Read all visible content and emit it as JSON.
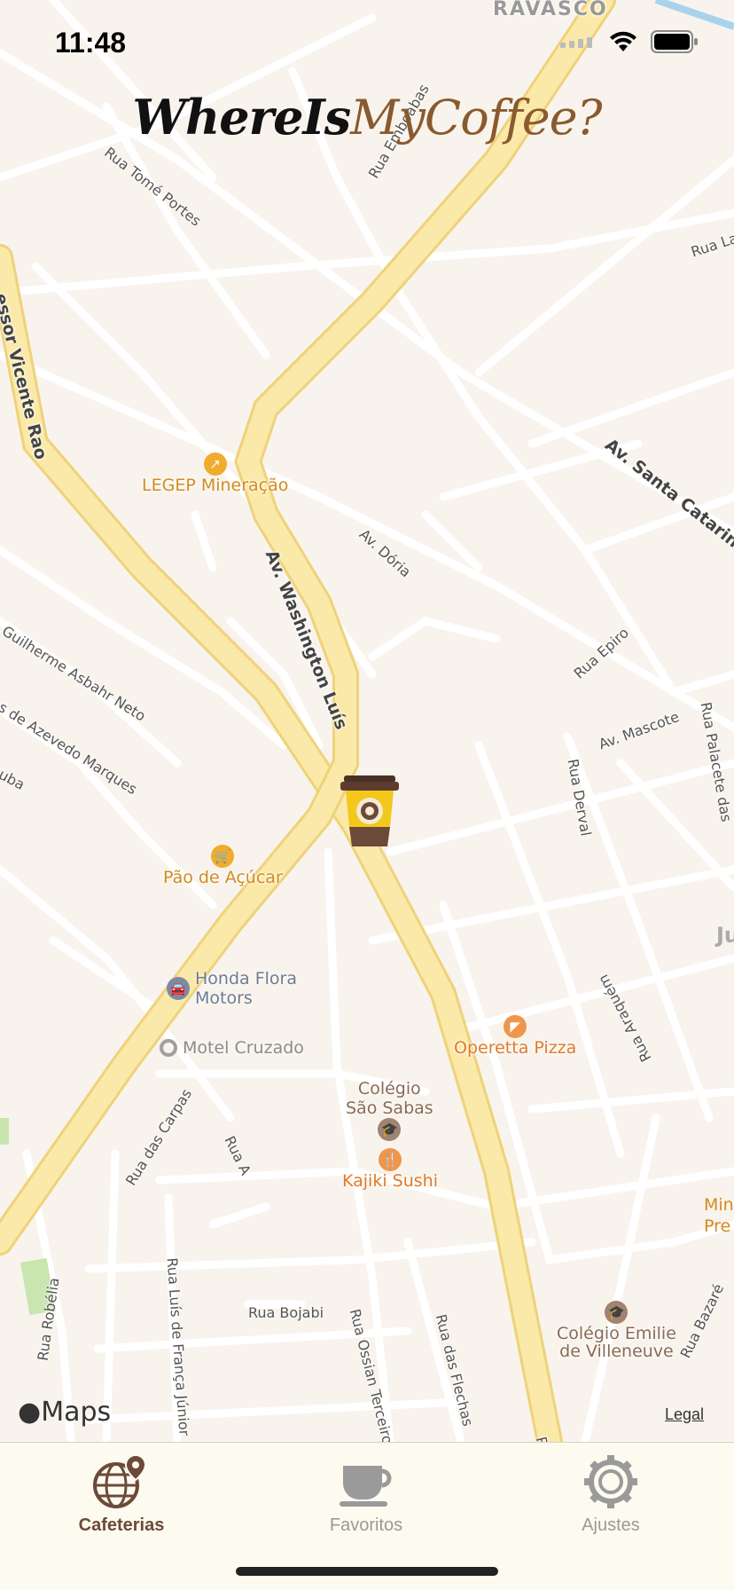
{
  "status_bar": {
    "time": "11:48"
  },
  "app_title": {
    "part1": "WhereIs",
    "part2": "MyCoffee?"
  },
  "map": {
    "neighborhood_label": "RAVASCO",
    "streets": [
      "Rua Emboabas",
      "Rua Tomé Portes",
      "Rua La",
      "essor Vicente Rao",
      "Av. Santa Catarina",
      "Av. Dória",
      "Av. Washington Luís",
      "Rua Epiro",
      "Av. Mascote",
      "Rua Palacete das",
      "Rua Derval",
      "Guilherme Asbahr Neto",
      "s de Azevedo Marques",
      "uba",
      "Rua das Carpas",
      "Rua A",
      "Rua Luís de França Júnior",
      "Rua Robélia",
      "Rua Bojabi",
      "Rua Ossian Terceiro",
      "Rua das Flechas",
      "Rua Araquém",
      "Rua Bazaré",
      "Ru"
    ],
    "pois": [
      {
        "label": "LEGEP Mineração",
        "color": "#f0ac2c"
      },
      {
        "label": "Pão de Açúcar",
        "color": "#f0ac2c"
      },
      {
        "label": "Honda Flora Motors",
        "line1": "Honda Flora",
        "line2": "Motors",
        "color": "#7e8aa3"
      },
      {
        "label": "Motel Cruzado",
        "color": "#9a9a9a"
      },
      {
        "label": "Operetta Pizza",
        "color": "#f0964a"
      },
      {
        "label": "Colégio São Sabas",
        "line1": "Colégio",
        "line2": "São Sabas",
        "color": "#a08370"
      },
      {
        "label": "Kajiki Sushi",
        "color": "#f0964a"
      },
      {
        "label": "Colégio Emilie de Villeneuve",
        "line1": "Colégio Emilie",
        "line2": "de Villeneuve",
        "color": "#a08370"
      },
      {
        "label": "Min Pre",
        "line1": "Min",
        "line2": "Pre",
        "color": "#f0ac2c"
      },
      {
        "label": "Ju",
        "color": "#aaa"
      }
    ],
    "attribution": "Maps",
    "legal": "Legal"
  },
  "tabs": [
    {
      "label": "Cafeterias",
      "icon": "globe-pin-icon",
      "active": true
    },
    {
      "label": "Favoritos",
      "icon": "coffee-cup-icon",
      "active": false
    },
    {
      "label": "Ajustes",
      "icon": "gear-icon",
      "active": false
    }
  ],
  "colors": {
    "active_tab": "#6b4a3a",
    "inactive_tab": "#9a9a9a",
    "major_road": "#fbe9a9",
    "minor_road": "#ffffff",
    "map_bg": "#f8f4ed"
  }
}
